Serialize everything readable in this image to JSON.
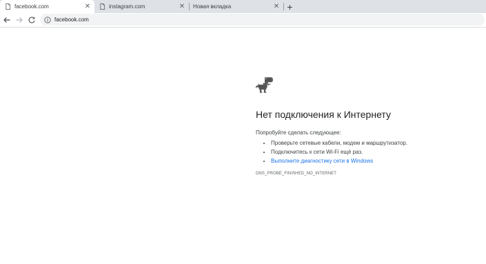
{
  "tabs": [
    {
      "title": "facebook.com",
      "active": true
    },
    {
      "title": "instagram.com",
      "active": false
    },
    {
      "title": "Новая вкладка",
      "active": false
    }
  ],
  "new_tab_glyph": "+",
  "close_glyph": "✕",
  "toolbar": {
    "back_icon": "arrow-left-icon",
    "forward_icon": "arrow-right-icon",
    "reload_icon": "reload-icon",
    "url": "facebook.com"
  },
  "error_page": {
    "icon": "offline-dino-icon",
    "heading": "Нет подключения к Интернету",
    "try_label": "Попробуйте сделать следующее:",
    "suggestions": [
      {
        "text": "Проверьте сетевые кабели, модем и маршрутизатор.",
        "link": false
      },
      {
        "text": "Подключитесь к сети Wi-Fi ещё раз.",
        "link": false
      },
      {
        "text": "Выполните диагностику сети в Windows",
        "link": true
      }
    ],
    "error_code": "DNS_PROBE_FINISHED_NO_INTERNET"
  },
  "colors": {
    "tabstrip": "#dee1e6",
    "link": "#1a73e8",
    "text": "#202124"
  }
}
